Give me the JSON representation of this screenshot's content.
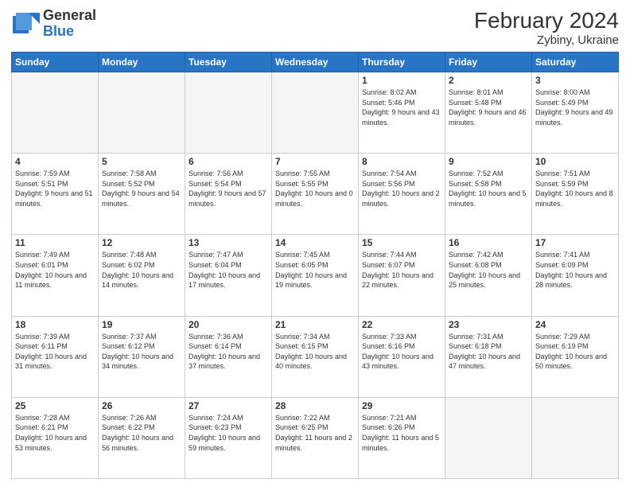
{
  "header": {
    "logo_general": "General",
    "logo_blue": "Blue",
    "month_year": "February 2024",
    "location": "Zybiny, Ukraine"
  },
  "days_of_week": [
    "Sunday",
    "Monday",
    "Tuesday",
    "Wednesday",
    "Thursday",
    "Friday",
    "Saturday"
  ],
  "weeks": [
    [
      {
        "day": "",
        "sunrise": "",
        "sunset": "",
        "daylight": "",
        "empty": true
      },
      {
        "day": "",
        "sunrise": "",
        "sunset": "",
        "daylight": "",
        "empty": true
      },
      {
        "day": "",
        "sunrise": "",
        "sunset": "",
        "daylight": "",
        "empty": true
      },
      {
        "day": "",
        "sunrise": "",
        "sunset": "",
        "daylight": "",
        "empty": true
      },
      {
        "day": "1",
        "sunrise": "Sunrise: 8:02 AM",
        "sunset": "Sunset: 5:46 PM",
        "daylight": "Daylight: 9 hours and 43 minutes.",
        "empty": false
      },
      {
        "day": "2",
        "sunrise": "Sunrise: 8:01 AM",
        "sunset": "Sunset: 5:48 PM",
        "daylight": "Daylight: 9 hours and 46 minutes.",
        "empty": false
      },
      {
        "day": "3",
        "sunrise": "Sunrise: 8:00 AM",
        "sunset": "Sunset: 5:49 PM",
        "daylight": "Daylight: 9 hours and 49 minutes.",
        "empty": false
      }
    ],
    [
      {
        "day": "4",
        "sunrise": "Sunrise: 7:59 AM",
        "sunset": "Sunset: 5:51 PM",
        "daylight": "Daylight: 9 hours and 51 minutes.",
        "empty": false
      },
      {
        "day": "5",
        "sunrise": "Sunrise: 7:58 AM",
        "sunset": "Sunset: 5:52 PM",
        "daylight": "Daylight: 9 hours and 54 minutes.",
        "empty": false
      },
      {
        "day": "6",
        "sunrise": "Sunrise: 7:56 AM",
        "sunset": "Sunset: 5:54 PM",
        "daylight": "Daylight: 9 hours and 57 minutes.",
        "empty": false
      },
      {
        "day": "7",
        "sunrise": "Sunrise: 7:55 AM",
        "sunset": "Sunset: 5:55 PM",
        "daylight": "Daylight: 10 hours and 0 minutes.",
        "empty": false
      },
      {
        "day": "8",
        "sunrise": "Sunrise: 7:54 AM",
        "sunset": "Sunset: 5:56 PM",
        "daylight": "Daylight: 10 hours and 2 minutes.",
        "empty": false
      },
      {
        "day": "9",
        "sunrise": "Sunrise: 7:52 AM",
        "sunset": "Sunset: 5:58 PM",
        "daylight": "Daylight: 10 hours and 5 minutes.",
        "empty": false
      },
      {
        "day": "10",
        "sunrise": "Sunrise: 7:51 AM",
        "sunset": "Sunset: 5:59 PM",
        "daylight": "Daylight: 10 hours and 8 minutes.",
        "empty": false
      }
    ],
    [
      {
        "day": "11",
        "sunrise": "Sunrise: 7:49 AM",
        "sunset": "Sunset: 6:01 PM",
        "daylight": "Daylight: 10 hours and 11 minutes.",
        "empty": false
      },
      {
        "day": "12",
        "sunrise": "Sunrise: 7:48 AM",
        "sunset": "Sunset: 6:02 PM",
        "daylight": "Daylight: 10 hours and 14 minutes.",
        "empty": false
      },
      {
        "day": "13",
        "sunrise": "Sunrise: 7:47 AM",
        "sunset": "Sunset: 6:04 PM",
        "daylight": "Daylight: 10 hours and 17 minutes.",
        "empty": false
      },
      {
        "day": "14",
        "sunrise": "Sunrise: 7:45 AM",
        "sunset": "Sunset: 6:05 PM",
        "daylight": "Daylight: 10 hours and 19 minutes.",
        "empty": false
      },
      {
        "day": "15",
        "sunrise": "Sunrise: 7:44 AM",
        "sunset": "Sunset: 6:07 PM",
        "daylight": "Daylight: 10 hours and 22 minutes.",
        "empty": false
      },
      {
        "day": "16",
        "sunrise": "Sunrise: 7:42 AM",
        "sunset": "Sunset: 6:08 PM",
        "daylight": "Daylight: 10 hours and 25 minutes.",
        "empty": false
      },
      {
        "day": "17",
        "sunrise": "Sunrise: 7:41 AM",
        "sunset": "Sunset: 6:09 PM",
        "daylight": "Daylight: 10 hours and 28 minutes.",
        "empty": false
      }
    ],
    [
      {
        "day": "18",
        "sunrise": "Sunrise: 7:39 AM",
        "sunset": "Sunset: 6:11 PM",
        "daylight": "Daylight: 10 hours and 31 minutes.",
        "empty": false
      },
      {
        "day": "19",
        "sunrise": "Sunrise: 7:37 AM",
        "sunset": "Sunset: 6:12 PM",
        "daylight": "Daylight: 10 hours and 34 minutes.",
        "empty": false
      },
      {
        "day": "20",
        "sunrise": "Sunrise: 7:36 AM",
        "sunset": "Sunset: 6:14 PM",
        "daylight": "Daylight: 10 hours and 37 minutes.",
        "empty": false
      },
      {
        "day": "21",
        "sunrise": "Sunrise: 7:34 AM",
        "sunset": "Sunset: 6:15 PM",
        "daylight": "Daylight: 10 hours and 40 minutes.",
        "empty": false
      },
      {
        "day": "22",
        "sunrise": "Sunrise: 7:33 AM",
        "sunset": "Sunset: 6:16 PM",
        "daylight": "Daylight: 10 hours and 43 minutes.",
        "empty": false
      },
      {
        "day": "23",
        "sunrise": "Sunrise: 7:31 AM",
        "sunset": "Sunset: 6:18 PM",
        "daylight": "Daylight: 10 hours and 47 minutes.",
        "empty": false
      },
      {
        "day": "24",
        "sunrise": "Sunrise: 7:29 AM",
        "sunset": "Sunset: 6:19 PM",
        "daylight": "Daylight: 10 hours and 50 minutes.",
        "empty": false
      }
    ],
    [
      {
        "day": "25",
        "sunrise": "Sunrise: 7:28 AM",
        "sunset": "Sunset: 6:21 PM",
        "daylight": "Daylight: 10 hours and 53 minutes.",
        "empty": false
      },
      {
        "day": "26",
        "sunrise": "Sunrise: 7:26 AM",
        "sunset": "Sunset: 6:22 PM",
        "daylight": "Daylight: 10 hours and 56 minutes.",
        "empty": false
      },
      {
        "day": "27",
        "sunrise": "Sunrise: 7:24 AM",
        "sunset": "Sunset: 6:23 PM",
        "daylight": "Daylight: 10 hours and 59 minutes.",
        "empty": false
      },
      {
        "day": "28",
        "sunrise": "Sunrise: 7:22 AM",
        "sunset": "Sunset: 6:25 PM",
        "daylight": "Daylight: 11 hours and 2 minutes.",
        "empty": false
      },
      {
        "day": "29",
        "sunrise": "Sunrise: 7:21 AM",
        "sunset": "Sunset: 6:26 PM",
        "daylight": "Daylight: 11 hours and 5 minutes.",
        "empty": false
      },
      {
        "day": "",
        "sunrise": "",
        "sunset": "",
        "daylight": "",
        "empty": true
      },
      {
        "day": "",
        "sunrise": "",
        "sunset": "",
        "daylight": "",
        "empty": true
      }
    ]
  ]
}
